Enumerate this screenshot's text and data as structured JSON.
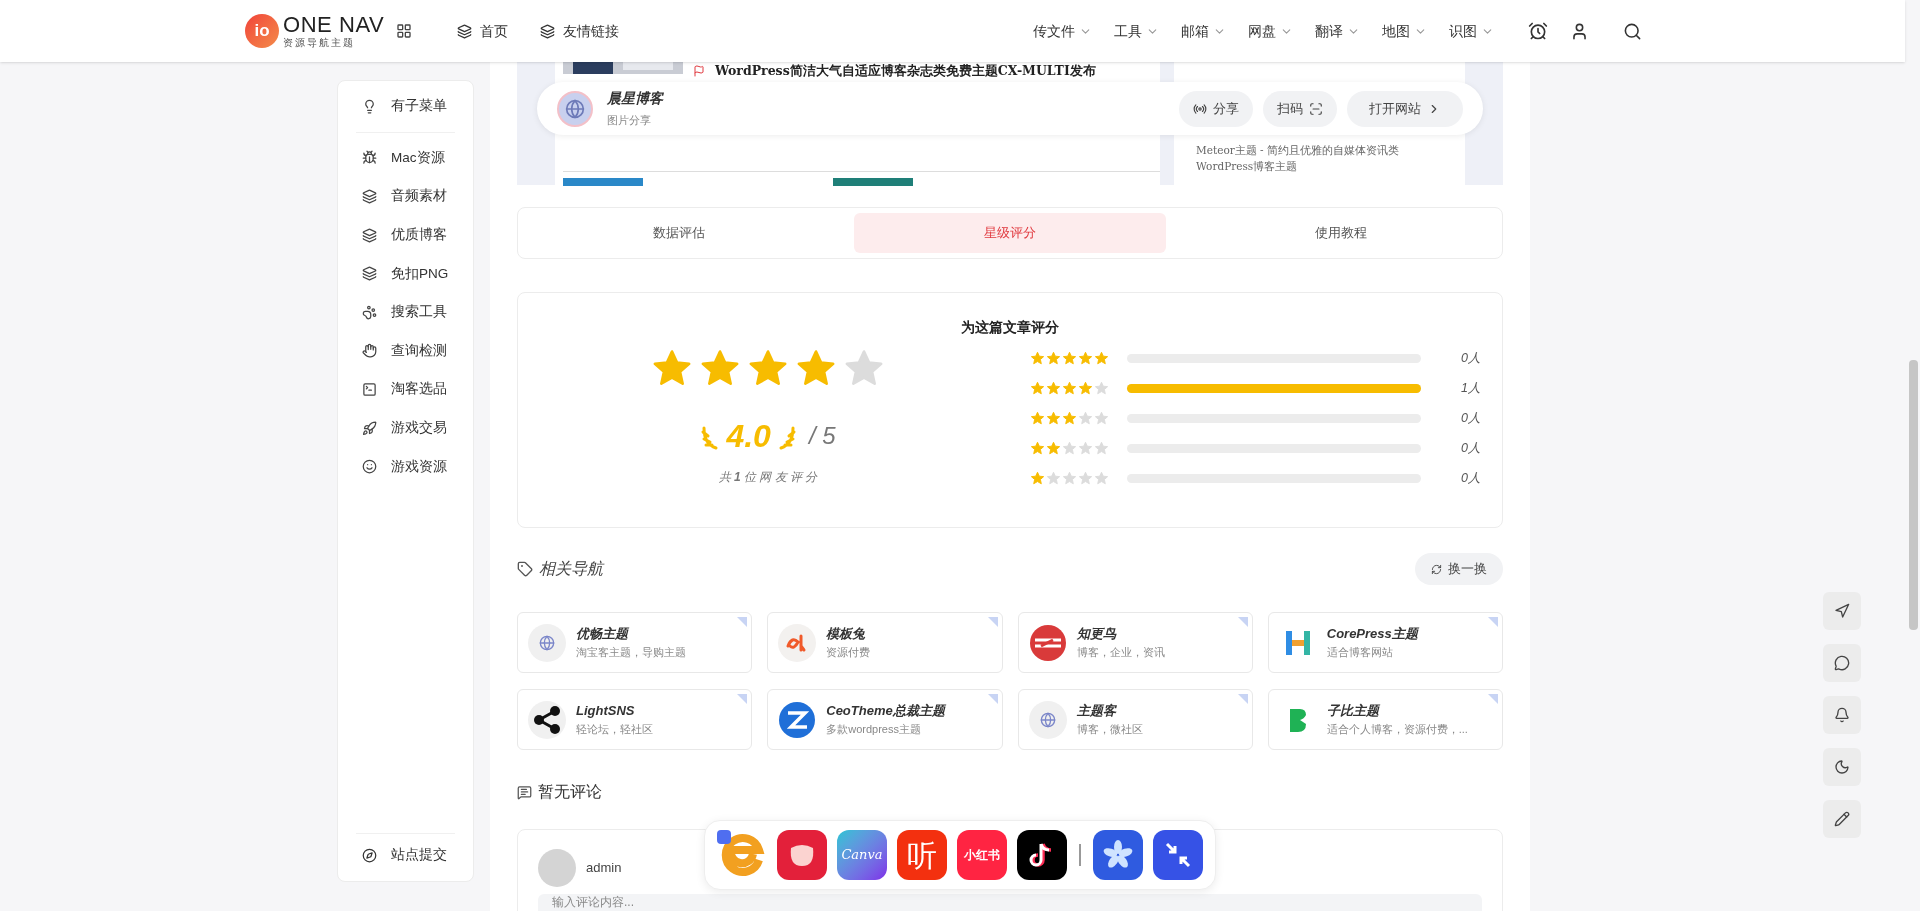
{
  "header": {
    "logo": {
      "mark": "io",
      "name": "ONE NAV",
      "tagline": "资源导航主题"
    },
    "nav": [
      {
        "label": "首页"
      },
      {
        "label": "友情链接"
      }
    ],
    "menus": [
      {
        "label": "传文件"
      },
      {
        "label": "工具"
      },
      {
        "label": "邮箱"
      },
      {
        "label": "网盘"
      },
      {
        "label": "翻译"
      },
      {
        "label": "地图"
      },
      {
        "label": "识图"
      }
    ]
  },
  "sidebar": {
    "items": [
      {
        "label": "有子菜单"
      },
      {
        "label": "Mac资源"
      },
      {
        "label": "音频素材"
      },
      {
        "label": "优质博客"
      },
      {
        "label": "免扣PNG"
      },
      {
        "label": "搜索工具"
      },
      {
        "label": "查询检测"
      },
      {
        "label": "淘客选品"
      },
      {
        "label": "游戏交易"
      },
      {
        "label": "游戏资源"
      }
    ],
    "footer": {
      "label": "站点提交"
    }
  },
  "preview": {
    "headline": "WordPress简洁大气自适应博客杂志类免费主题CX-MULTI发布",
    "side_text": "Meteor主题 - 简约且优雅的自媒体资讯类WordPress博客主题"
  },
  "site": {
    "name": "晨星博客",
    "category": "图片分享",
    "actions": [
      {
        "label": "分享"
      },
      {
        "label": "扫码"
      },
      {
        "label": "打开网站"
      }
    ]
  },
  "tabs": [
    {
      "label": "数据评估",
      "selected": false
    },
    {
      "label": "星级评分",
      "selected": true
    },
    {
      "label": "使用教程",
      "selected": false
    }
  ],
  "rating": {
    "title": "为这篇文章评分",
    "stars": 4,
    "score": "4.0",
    "max": "/ 5",
    "summary": "共 **1** 位 网 友 评 分",
    "breakdown": [
      {
        "stars": 5,
        "count": "0人"
      },
      {
        "stars": 4,
        "level": 1,
        "count": "1人"
      },
      {
        "stars": 3,
        "count": "0人"
      },
      {
        "stars": 2,
        "count": "0人"
      },
      {
        "stars": 1,
        "count": "0人"
      }
    ]
  },
  "related": {
    "title": "相关导航",
    "refresh": "换一换",
    "items": [
      {
        "name": "优畅主题",
        "desc": "淘宝客主题，导购主题"
      },
      {
        "name": "模板兔",
        "desc": "资源付费"
      },
      {
        "name": "知更鸟",
        "desc": "博客，企业，资讯"
      },
      {
        "name": "CorePress主题",
        "desc": "适合博客网站"
      },
      {
        "name": "LightSNS",
        "desc": "轻论坛，轻社区"
      },
      {
        "name": "CeoTheme总裁主题",
        "desc": "多款wordpress主题"
      },
      {
        "name": "主题客",
        "desc": "博客，微社区"
      },
      {
        "name": "子比主题",
        "desc": "适合个人博客，资源付费，..."
      }
    ]
  },
  "comments": {
    "title": "暂无评论",
    "user": "admin",
    "placeholder": "输入评论内容..."
  },
  "dock": [
    {
      "kind": "icon"
    },
    {
      "kind": "icon"
    },
    {
      "kind": "text",
      "label": "Canva"
    },
    {
      "kind": "text",
      "label": "听"
    },
    {
      "kind": "text",
      "label": "小红书"
    },
    {
      "kind": "icon"
    },
    {
      "kind": "icon"
    },
    {
      "kind": "icon"
    }
  ]
}
